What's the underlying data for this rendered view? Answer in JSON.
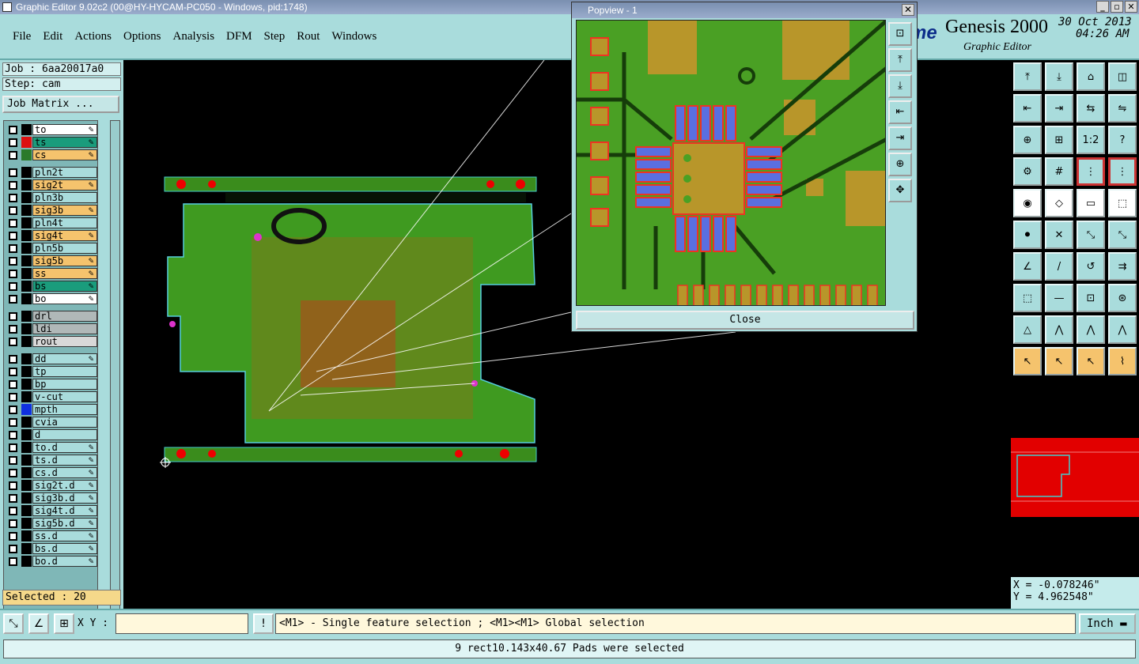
{
  "window": {
    "title": "Graphic Editor 9.02c2 (00@HY-HYCAM-PC050 - Windows, pid:1748)",
    "min": "_",
    "max": "▫",
    "close": "✕"
  },
  "menu": [
    "File",
    "Edit",
    "Actions",
    "Options",
    "Analysis",
    "DFM",
    "Step",
    "Rout",
    "Windows"
  ],
  "brand": {
    "logo": "me",
    "name": "Genesis 2000",
    "subtitle": "Graphic Editor",
    "date": "30 Oct 2013",
    "time": "04:26 AM"
  },
  "job": {
    "job_label": "Job : 6aa20017a0",
    "step_label": "Step: cam",
    "matrix_button": "Job Matrix ..."
  },
  "layers": [
    {
      "name": "to",
      "color": "#ffffff",
      "swatch": "#000000",
      "edit": true
    },
    {
      "name": "ts",
      "color": "#1a9c7c",
      "swatch": "#d11",
      "edit": true
    },
    {
      "name": "cs",
      "color": "#f5c36d",
      "swatch": "#2a7a2a",
      "edit": true,
      "work": true
    },
    {
      "name": "pln2t",
      "color": "#a9dcdc",
      "swatch": "#000000",
      "edit": false
    },
    {
      "name": "sig2t",
      "color": "#f5c36d",
      "swatch": "#000000",
      "edit": true
    },
    {
      "name": "pln3b",
      "color": "#a9dcdc",
      "swatch": "#000000",
      "edit": false
    },
    {
      "name": "sig3b",
      "color": "#f5c36d",
      "swatch": "#000000",
      "edit": true
    },
    {
      "name": "pln4t",
      "color": "#a9dcdc",
      "swatch": "#000000",
      "edit": false
    },
    {
      "name": "sig4t",
      "color": "#f5c36d",
      "swatch": "#000000",
      "edit": true
    },
    {
      "name": "pln5b",
      "color": "#a9dcdc",
      "swatch": "#000000",
      "edit": false
    },
    {
      "name": "sig5b",
      "color": "#f5c36d",
      "swatch": "#000000",
      "edit": true
    },
    {
      "name": "ss",
      "color": "#f5c36d",
      "swatch": "#000000",
      "edit": true
    },
    {
      "name": "bs",
      "color": "#1a9c7c",
      "swatch": "#000000",
      "edit": true
    },
    {
      "name": "bo",
      "color": "#ffffff",
      "swatch": "#000000",
      "edit": true
    },
    {
      "name": "drl",
      "color": "#b0b8b8",
      "swatch": "#000000",
      "edit": false
    },
    {
      "name": "ldi",
      "color": "#b0b8b8",
      "swatch": "#000000",
      "edit": false
    },
    {
      "name": "rout",
      "color": "#d8d8d8",
      "swatch": "#000000",
      "edit": false
    },
    {
      "name": "dd",
      "color": "#a9dcdc",
      "swatch": "#000000",
      "edit": true
    },
    {
      "name": "tp",
      "color": "#a9dcdc",
      "swatch": "#000000",
      "edit": false
    },
    {
      "name": "bp",
      "color": "#a9dcdc",
      "swatch": "#000000",
      "edit": false
    },
    {
      "name": "v-cut",
      "color": "#a9dcdc",
      "swatch": "#000000",
      "edit": false
    },
    {
      "name": "mpth",
      "color": "#a9dcdc",
      "swatch": "#1030e0",
      "edit": false
    },
    {
      "name": "cvia",
      "color": "#a9dcdc",
      "swatch": "#000000",
      "edit": false
    },
    {
      "name": "d",
      "color": "#a9dcdc",
      "swatch": "#000000",
      "edit": false
    },
    {
      "name": "to.d",
      "color": "#a9dcdc",
      "swatch": "#000000",
      "edit": true
    },
    {
      "name": "ts.d",
      "color": "#a9dcdc",
      "swatch": "#000000",
      "edit": true
    },
    {
      "name": "cs.d",
      "color": "#a9dcdc",
      "swatch": "#000000",
      "edit": true
    },
    {
      "name": "sig2t.d",
      "color": "#a9dcdc",
      "swatch": "#000000",
      "edit": true
    },
    {
      "name": "sig3b.d",
      "color": "#a9dcdc",
      "swatch": "#000000",
      "edit": true
    },
    {
      "name": "sig4t.d",
      "color": "#a9dcdc",
      "swatch": "#000000",
      "edit": true
    },
    {
      "name": "sig5b.d",
      "color": "#a9dcdc",
      "swatch": "#000000",
      "edit": true
    },
    {
      "name": "ss.d",
      "color": "#a9dcdc",
      "swatch": "#000000",
      "edit": true
    },
    {
      "name": "bs.d",
      "color": "#a9dcdc",
      "swatch": "#000000",
      "edit": true
    },
    {
      "name": "bo.d",
      "color": "#a9dcdc",
      "swatch": "#000000",
      "edit": true
    }
  ],
  "selected": "Selected : 20",
  "coords": {
    "x": "X = -0.078246\"",
    "y": "Y =  4.962548\""
  },
  "status": {
    "xy_label": "X Y :",
    "xy_value": "",
    "hint": "<M1> - Single feature selection ; <M1><M1> Global selection",
    "unit": "Inch"
  },
  "message": "9 rect10.143x40.67 Pads were selected",
  "popview": {
    "title": "Popview - 1",
    "close_label": "Close"
  },
  "tools": {
    "row_icons": [
      "⤒",
      "⤓",
      "⌂",
      "◫",
      "⇤",
      "⇥",
      "⇆",
      "⇋",
      "⊕",
      "⊞",
      "1:2",
      "?",
      "⚙",
      "#",
      "⋮",
      "⋮",
      "◉",
      "◇",
      "▭",
      "⬚",
      "⚫",
      "✕",
      "⤡",
      "⤡",
      "∠",
      "/",
      "↺",
      "⇉",
      "⬚",
      "—",
      "⊡",
      "⊛",
      "△",
      "⋀",
      "⋀",
      "⋀",
      "↖",
      "↖",
      "↖",
      "⌇"
    ]
  }
}
